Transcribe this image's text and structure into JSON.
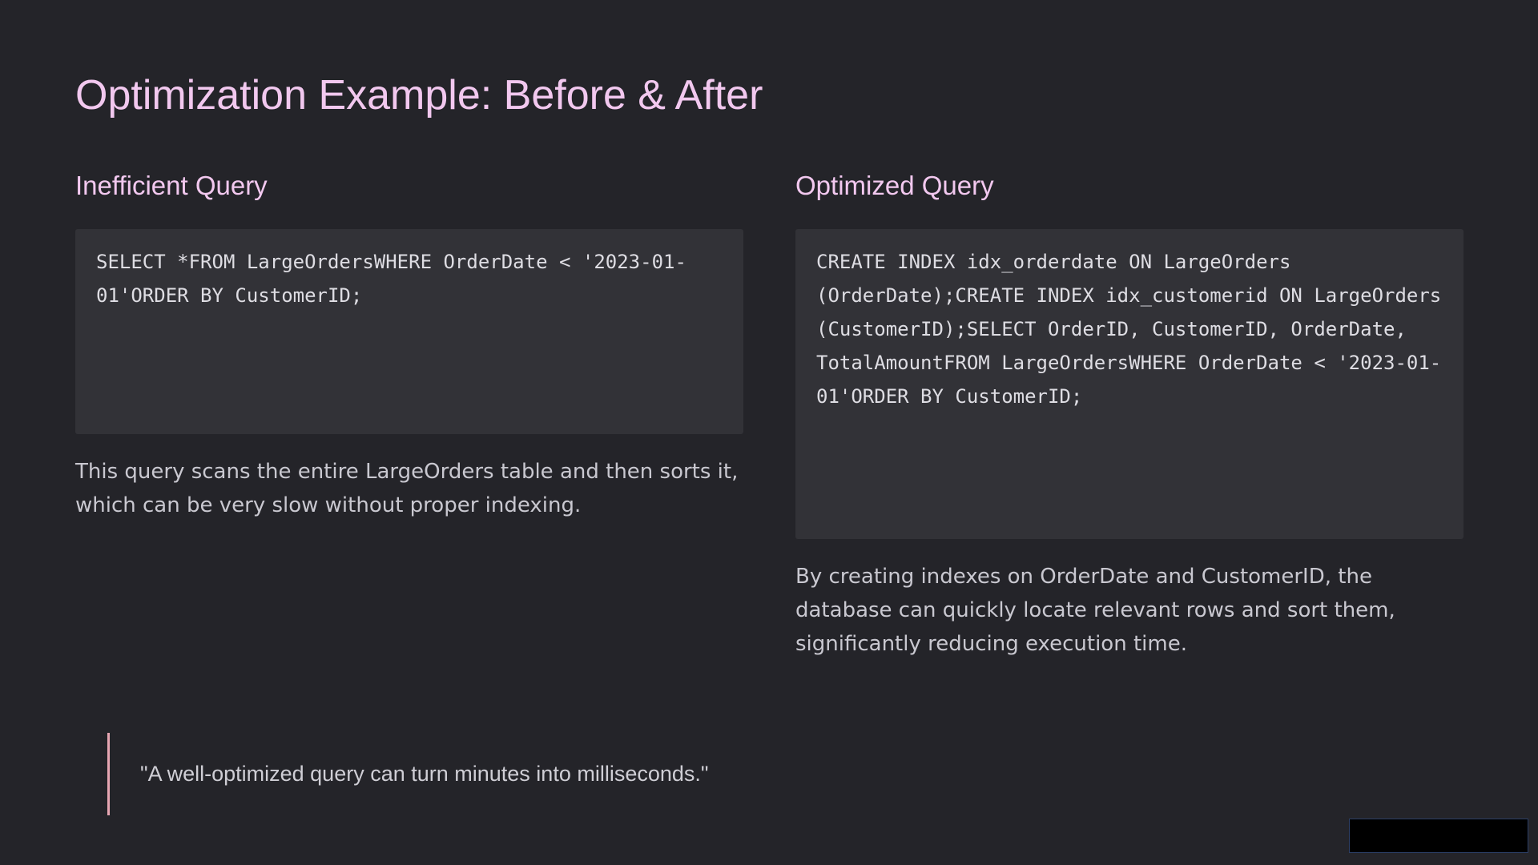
{
  "slide": {
    "title": "Optimization Example: Before & After"
  },
  "inefficient": {
    "heading": "Inefficient Query",
    "code": "SELECT *FROM LargeOrdersWHERE OrderDate < '2023-01-01'ORDER BY CustomerID;",
    "description": "This query scans the entire LargeOrders table and then sorts it, which can be very slow without proper indexing."
  },
  "optimized": {
    "heading": "Optimized Query",
    "code": "CREATE INDEX idx_orderdate ON LargeOrders (OrderDate);CREATE INDEX idx_customerid ON LargeOrders (CustomerID);SELECT OrderID, CustomerID, OrderDate, TotalAmountFROM LargeOrdersWHERE OrderDate < '2023-01-01'ORDER BY CustomerID;",
    "description": "By creating indexes on OrderDate and CustomerID, the database can quickly locate relevant rows and sort them, significantly reducing execution time."
  },
  "quote": {
    "text": "\"A well-optimized query can turn minutes into milliseconds.\""
  },
  "colors": {
    "background": "#242429",
    "heading": "#f2c8ef",
    "code_background": "#323237",
    "quote_accent": "#e7a6b3"
  }
}
